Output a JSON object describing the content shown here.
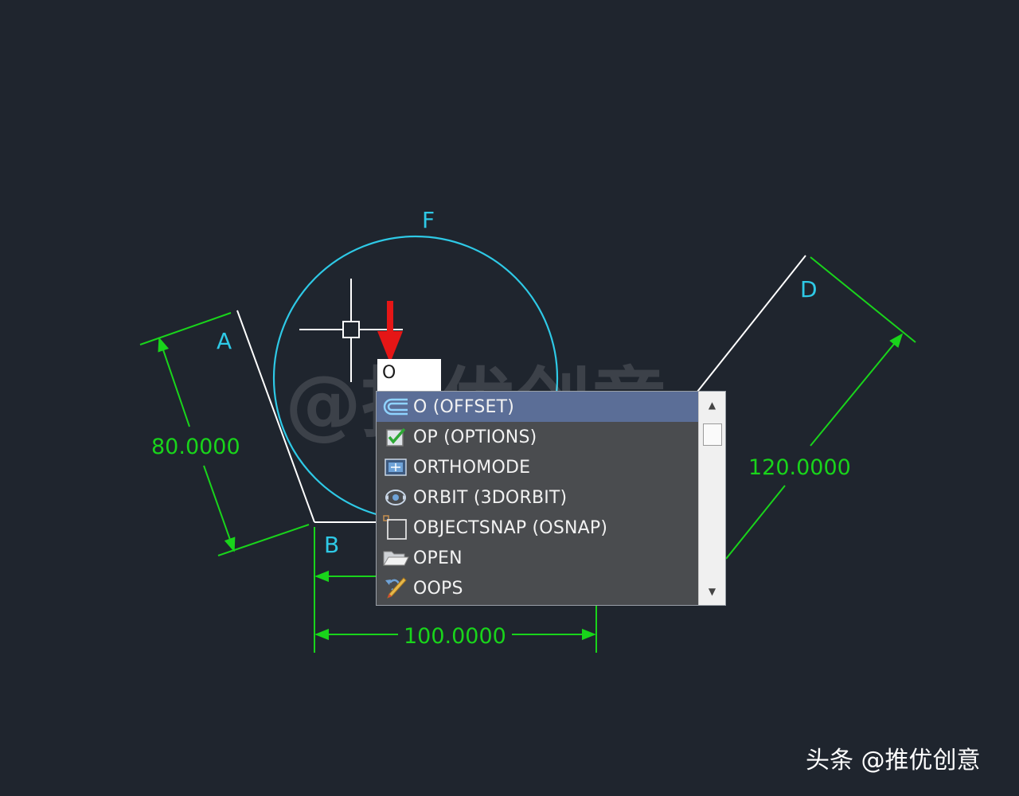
{
  "drawing": {
    "labels": {
      "a": "A",
      "b": "B",
      "d": "D",
      "f": "F"
    },
    "dimensions": {
      "a_length": "80.0000",
      "b_length": "100.0000",
      "d_length": "120.0000"
    },
    "colors": {
      "background": "#1f252e",
      "geometry": "#ffffff",
      "circle": "#2ec9e6",
      "dimension": "#19d41b",
      "label": "#2ec9e6",
      "arrow": "#e51616"
    },
    "watermark_center": "@推优创意"
  },
  "command_line": {
    "value": "O"
  },
  "autocomplete": {
    "items": [
      {
        "icon": "offset-icon",
        "label": "O (OFFSET)",
        "selected": true
      },
      {
        "icon": "options-check-icon",
        "label": "OP (OPTIONS)",
        "selected": false
      },
      {
        "icon": "orthomode-icon",
        "label": "ORTHOMODE",
        "selected": false
      },
      {
        "icon": "orbit-icon",
        "label": "ORBIT (3DORBIT)",
        "selected": false
      },
      {
        "icon": "objectsnap-icon",
        "label": "OBJECTSNAP (OSNAP)",
        "selected": false
      },
      {
        "icon": "open-folder-icon",
        "label": "OPEN",
        "selected": false
      },
      {
        "icon": "oops-icon",
        "label": "OOPS",
        "selected": false
      }
    ],
    "scroll_up_icon": "▲",
    "scroll_down_icon": "▼"
  },
  "footer": {
    "watermark": "头条 @推优创意"
  }
}
